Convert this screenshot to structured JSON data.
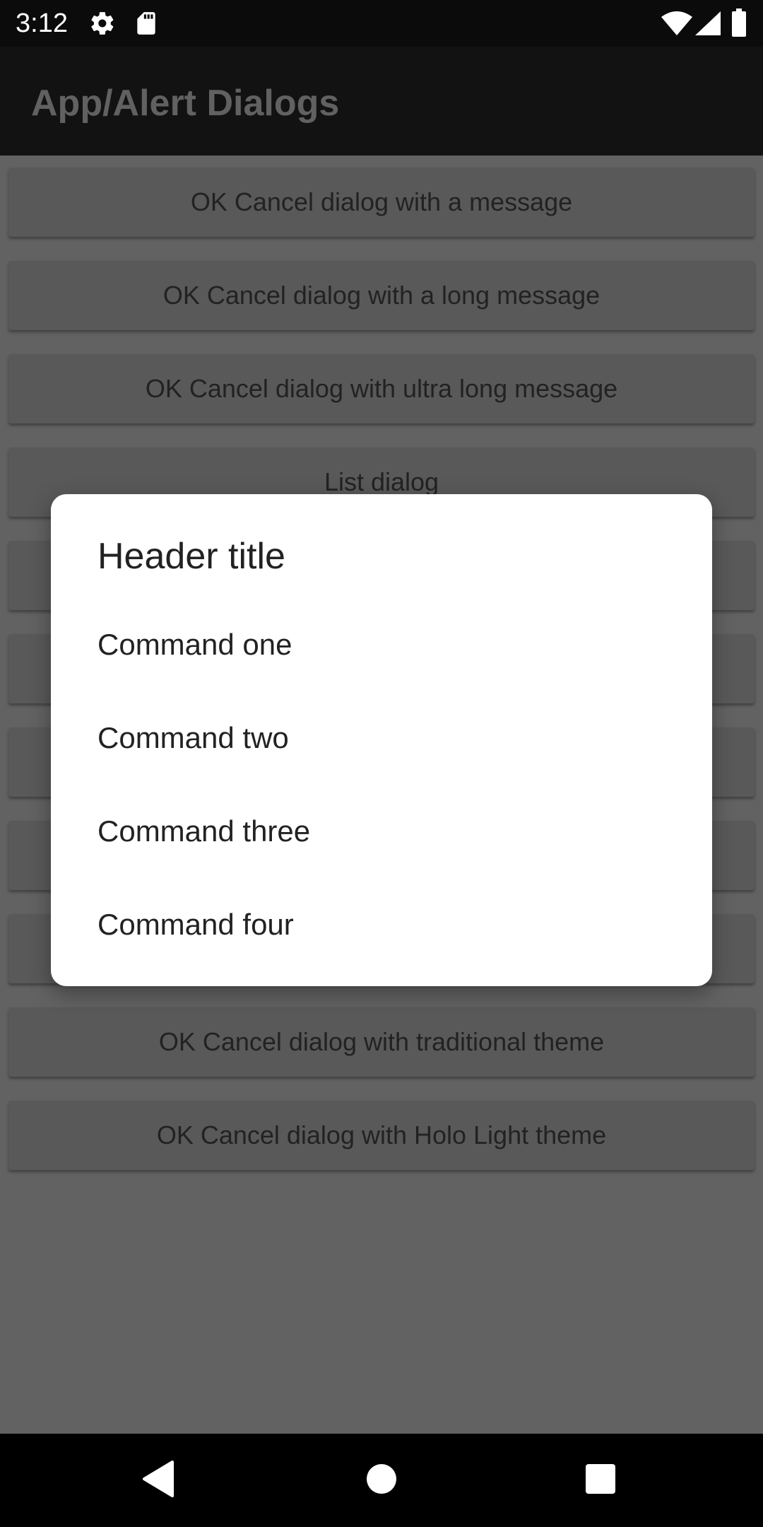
{
  "status_bar": {
    "time": "3:12",
    "icons": [
      "gear-icon",
      "sd-card-icon",
      "wifi-icon",
      "cell-signal-icon",
      "battery-icon"
    ]
  },
  "app_bar": {
    "title": "App/Alert Dialogs"
  },
  "buttons": [
    "OK Cancel dialog with a message",
    "OK Cancel dialog with a long message",
    "OK Cancel dialog with ultra long message",
    "List dialog",
    "",
    "",
    "",
    "",
    "",
    "OK Cancel dialog with traditional theme",
    "OK Cancel dialog with Holo Light theme"
  ],
  "dialog": {
    "title": "Header title",
    "items": [
      "Command one",
      "Command two",
      "Command three",
      "Command four"
    ]
  },
  "nav_bar": {
    "icons": [
      "back-icon",
      "home-icon",
      "recents-icon"
    ]
  },
  "colors": {
    "scrim_background": "#626262",
    "button_background": "#595959",
    "app_bar": "#121212",
    "dialog": "#ffffff"
  }
}
